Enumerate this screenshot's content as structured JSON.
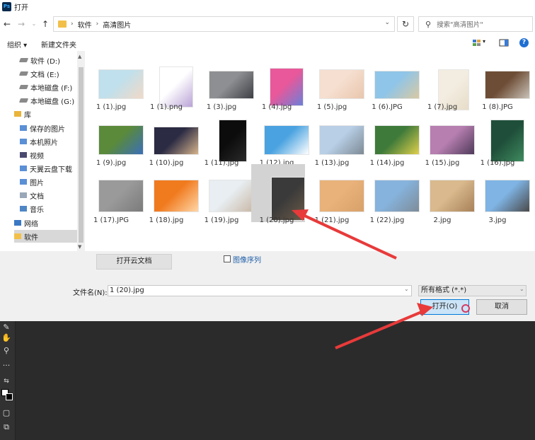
{
  "window": {
    "app_icon": "Ps",
    "title": "打开"
  },
  "address_bar": {
    "breadcrumb": [
      "软件",
      "高清图片"
    ],
    "search_placeholder": "搜索\"高清图片\""
  },
  "toolbar": {
    "organize": "组织",
    "new_folder": "新建文件夹"
  },
  "sidebar": {
    "items": [
      {
        "label": "软件 (D:)",
        "icon": "drive-icon"
      },
      {
        "label": "文档 (E:)",
        "icon": "drive-icon"
      },
      {
        "label": "本地磁盘 (F:)",
        "icon": "drive-icon"
      },
      {
        "label": "本地磁盘 (G:)",
        "icon": "drive-icon"
      },
      {
        "label": "库",
        "icon": "library-icon"
      },
      {
        "label": "保存的图片",
        "icon": "pictures-icon"
      },
      {
        "label": "本机照片",
        "icon": "pictures-icon"
      },
      {
        "label": "视频",
        "icon": "video-icon"
      },
      {
        "label": "天翼云盘下载",
        "icon": "pictures-icon"
      },
      {
        "label": "图片",
        "icon": "pictures-icon"
      },
      {
        "label": "文档",
        "icon": "document-icon"
      },
      {
        "label": "音乐",
        "icon": "music-icon"
      },
      {
        "label": "网络",
        "icon": "network-icon"
      },
      {
        "label": "软件",
        "icon": "folder-icon"
      }
    ]
  },
  "files": [
    {
      "name": "1 (1).jpg",
      "colors": [
        "#bfe0ec",
        "#f1d9c7"
      ]
    },
    {
      "name": "1 (1).png",
      "colors": [
        "#ffffff",
        "#b9a3d6"
      ]
    },
    {
      "name": "1 (3).jpg",
      "colors": [
        "#8d8f92",
        "#3d3f45"
      ]
    },
    {
      "name": "1 (4).jpg",
      "colors": [
        "#e8589a",
        "#6c7fd8"
      ]
    },
    {
      "name": "1 (5).jpg",
      "colors": [
        "#f6dfd0",
        "#e9c6ad"
      ]
    },
    {
      "name": "1 (6).JPG",
      "colors": [
        "#8fc5e8",
        "#d9c9a3"
      ]
    },
    {
      "name": "1 (7).jpg",
      "colors": [
        "#f3ede1",
        "#e7dcc8"
      ]
    },
    {
      "name": "1 (8).JPG",
      "colors": [
        "#6e4d36",
        "#c9c2b8"
      ]
    },
    {
      "name": "1 (9).jpg",
      "colors": [
        "#5a8a3a",
        "#3b6fb8"
      ]
    },
    {
      "name": "1 (10).jpg",
      "colors": [
        "#2b2b44",
        "#d7b48b"
      ]
    },
    {
      "name": "1 (11).jpg",
      "colors": [
        "#0c0c0c",
        "#2a2a2a"
      ]
    },
    {
      "name": "1 (12).jpg",
      "colors": [
        "#4aa3e0",
        "#ffffff"
      ]
    },
    {
      "name": "1 (13).jpg",
      "colors": [
        "#b8cfe6",
        "#7d8a95"
      ]
    },
    {
      "name": "1 (14).jpg",
      "colors": [
        "#3e7a3a",
        "#e0d04a"
      ]
    },
    {
      "name": "1 (15).jpg",
      "colors": [
        "#b77fb0",
        "#4f3a5a"
      ]
    },
    {
      "name": "1 (16).jpg",
      "colors": [
        "#1f4f3a",
        "#3f8a5e"
      ]
    },
    {
      "name": "1 (17).JPG",
      "colors": [
        "#9a9a9a",
        "#7b7b7b"
      ]
    },
    {
      "name": "1 (18).jpg",
      "colors": [
        "#f07a1e",
        "#ffd7a8"
      ]
    },
    {
      "name": "1 (19).jpg",
      "colors": [
        "#e8eef2",
        "#c9b8a6"
      ]
    },
    {
      "name": "1 (20).jpg",
      "colors": [
        "#3a3a3a",
        "#6a5a48"
      ]
    },
    {
      "name": "1 (21).jpg",
      "colors": [
        "#e9b27a",
        "#d8a16a"
      ]
    },
    {
      "name": "1 (22).jpg",
      "colors": [
        "#86b3dd",
        "#7e8c99"
      ]
    },
    {
      "name": "2.jpg",
      "colors": [
        "#d9b98d",
        "#a88158"
      ]
    },
    {
      "name": "3.jpg",
      "colors": [
        "#7fb4e4",
        "#4a4a4a"
      ]
    }
  ],
  "selected_file_index": 19,
  "bottom": {
    "cloud_button": "打开云文档",
    "image_sequence": "图像序列",
    "filename_label": "文件名(N):",
    "filename_value": "1 (20).jpg",
    "filetype_value": "所有格式 (*.*)",
    "open_button": "打开(O)",
    "cancel_button": "取消"
  },
  "colors": {
    "accent": "#0078d7",
    "ps_background": "#2b2b2b",
    "annotation_arrow": "#e83a3a"
  }
}
